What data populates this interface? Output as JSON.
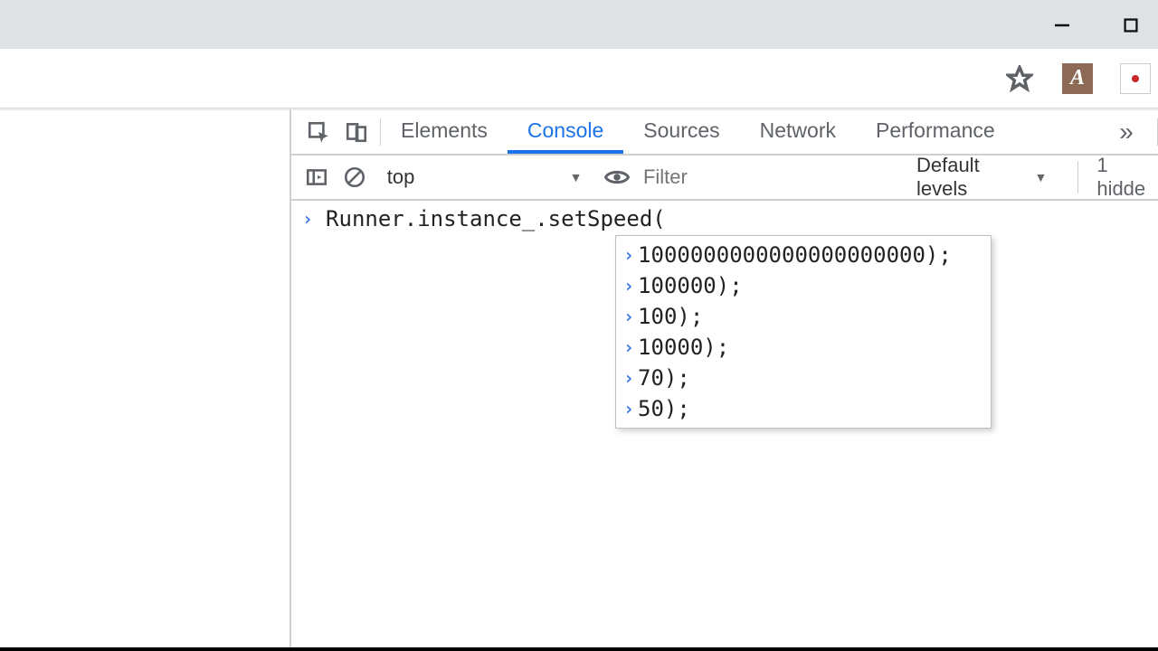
{
  "window": {
    "minimize_tooltip": "Minimize",
    "maximize_tooltip": "Maximize"
  },
  "toolbar": {
    "star_tooltip": "Bookmark this page",
    "ext_pdf_label": "A",
    "ext_other_tooltip": "Extension"
  },
  "devtools": {
    "tabs": {
      "elements": "Elements",
      "console": "Console",
      "sources": "Sources",
      "network": "Network",
      "performance": "Performance",
      "more": "»"
    },
    "console_toolbar": {
      "context": "top",
      "filter_placeholder": "Filter",
      "levels_label": "Default levels",
      "hidden_label": "1 hidde"
    },
    "console": {
      "prompt_prefix": "Runner.instance_.setSpeed(",
      "autocomplete": [
        "1000000000000000000000);",
        "100000);",
        "100);",
        "10000);",
        "70);",
        "50);"
      ]
    }
  }
}
